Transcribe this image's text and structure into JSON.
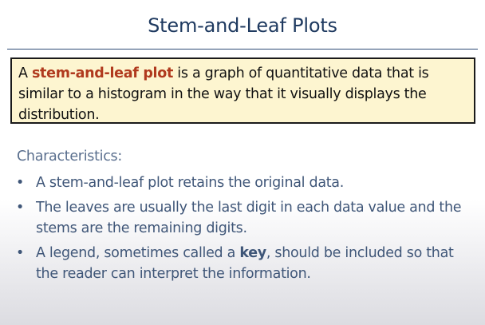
{
  "slide": {
    "title": "Stem-and-Leaf Plots",
    "definition": {
      "lead": "A ",
      "term": "stem-and-leaf plot",
      "rest": " is a graph of quantitative data that is similar to a histogram in the way that it visually displays the distribution."
    },
    "characteristics_heading": "Characteristics:",
    "bullet_marker": "•",
    "bullets": [
      {
        "text": "A stem-and-leaf plot retains the original data."
      },
      {
        "text": "The leaves are usually the last digit in each data value and the stems are the remaining digits."
      },
      {
        "before": "A legend, sometimes called a ",
        "emphasis": "key",
        "after": ", should be included so that the reader can interpret the information."
      }
    ]
  },
  "colors": {
    "title": "#1f3a60",
    "term": "#b03a1e",
    "box_fill": "#fdf5d0",
    "body_text": "#3f5678"
  }
}
